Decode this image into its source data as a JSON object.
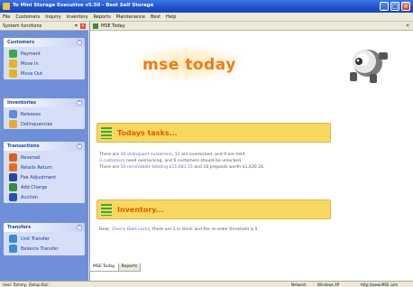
{
  "window": {
    "title": "To Mini Storage Executive v5.50 - Best Self Storage"
  },
  "menu": [
    "File",
    "Customers",
    "Inquiry",
    "Inventory",
    "Reports",
    "Maintenance",
    "Best",
    "Help"
  ],
  "left_pane": {
    "header": "System functions",
    "panels": [
      {
        "title": "Customers",
        "items": [
          {
            "label": "Payment",
            "icon": "payment-icon",
            "color": "#3aa84a"
          },
          {
            "label": "Move In",
            "icon": "move-in-icon",
            "color": "#e8b21a"
          },
          {
            "label": "Move Out",
            "icon": "move-out-icon",
            "color": "#e8b21a"
          }
        ]
      },
      {
        "title": "Inventories",
        "items": [
          {
            "label": "Releases",
            "icon": "releases-icon",
            "color": "#5e8ad8"
          },
          {
            "label": "Delinquencies",
            "icon": "delinquencies-icon",
            "color": "#e8a838"
          }
        ]
      },
      {
        "title": "Transactions",
        "items": [
          {
            "label": "Reversal",
            "icon": "reversal-icon",
            "color": "#e06020"
          },
          {
            "label": "Retails Return",
            "icon": "retails-return-icon",
            "color": "#e86f1a"
          },
          {
            "label": "Fee Adjustment",
            "icon": "fee-adjustment-icon",
            "color": "#27479c"
          },
          {
            "label": "Add Charge",
            "icon": "add-charge-icon",
            "color": "#3a8a3a"
          },
          {
            "label": "Auction",
            "icon": "auction-icon",
            "color": "#2a50b8"
          }
        ]
      },
      {
        "title": "Transfers",
        "items": [
          {
            "label": "Unit Transfer",
            "icon": "unit-transfer-icon",
            "color": "#3a8ad8"
          },
          {
            "label": "Balance Transfer",
            "icon": "balance-transfer-icon",
            "color": "#3a8ad8"
          }
        ]
      }
    ]
  },
  "main": {
    "header": "MSE Today",
    "logo_text": "mse today",
    "section1_title": "Todays tasks...",
    "tasks_lines": [
      {
        "pre": "There are ",
        "link": "40 delinquent customers",
        "post": ", 11 are overlocked, and 9 are held."
      },
      {
        "pre": "",
        "link": "3 customers",
        "post": " need overlocking, and 6 customers should be unlocked."
      },
      {
        "pre": "There are ",
        "link": "50 receivables totaling $11,681.15",
        "post": " and 10 prepaids worth $1,630.16."
      }
    ],
    "section2_title": "Inventory...",
    "inventory_line": {
      "pre": "Dear, ",
      "link": "Cherry Date Locks",
      "post": ", there are 3 in stock and the re-order threshold is 5."
    }
  },
  "tabs": [
    "MSE Today",
    "Reports"
  ],
  "status": {
    "left": "User: Tommy, (Setup Biz)",
    "network": "Network",
    "os": "Windows XP",
    "url": "http://www.MSE.com"
  },
  "colors": {
    "accent": "#f07a18",
    "section_bg": "#f7d860",
    "pane_bg": "#6f8fd8"
  }
}
